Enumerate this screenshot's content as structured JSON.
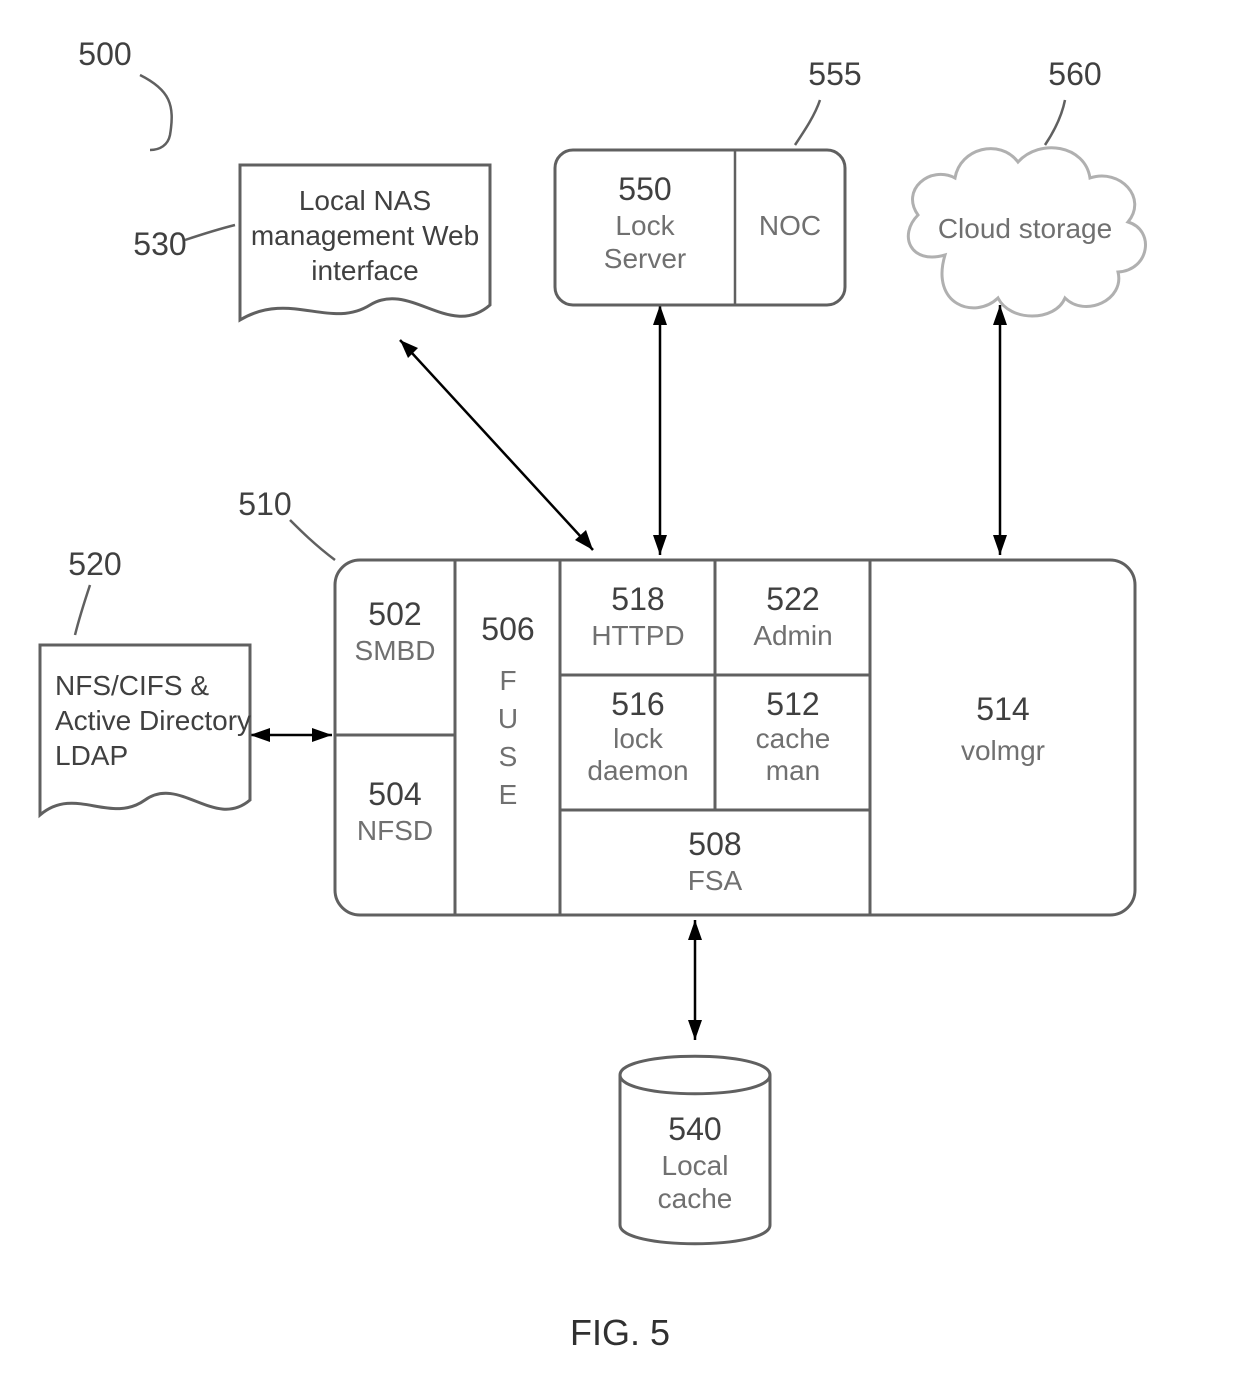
{
  "figure": {
    "caption": "FIG. 5"
  },
  "refs": {
    "r500": "500",
    "r530": "530",
    "r555": "555",
    "r560": "560",
    "r520": "520",
    "r510": "510"
  },
  "boxes": {
    "nas_web": {
      "l1": "Local NAS",
      "l2": "management Web",
      "l3": "interface"
    },
    "lock_server": {
      "num": "550",
      "name": "Lock",
      "name2": "Server"
    },
    "noc": {
      "name": "NOC"
    },
    "cloud": {
      "name": "Cloud storage"
    },
    "nfs_cifs": {
      "l1": "NFS/CIFS &",
      "l2": "Active Directory",
      "l3": "LDAP"
    },
    "smbd": {
      "num": "502",
      "name": "SMBD"
    },
    "nfsd": {
      "num": "504",
      "name": "NFSD"
    },
    "fuse": {
      "num": "506",
      "c1": "F",
      "c2": "U",
      "c3": "S",
      "c4": "E"
    },
    "httpd": {
      "num": "518",
      "name": "HTTPD"
    },
    "admin": {
      "num": "522",
      "name": "Admin"
    },
    "lockd": {
      "num": "516",
      "name1": "lock",
      "name2": "daemon"
    },
    "cacheman": {
      "num": "512",
      "name1": "cache",
      "name2": "man"
    },
    "fsa": {
      "num": "508",
      "name": "FSA"
    },
    "volmgr": {
      "num": "514",
      "name": "volmgr"
    },
    "local_cache": {
      "num": "540",
      "name1": "Local",
      "name2": "cache"
    }
  }
}
